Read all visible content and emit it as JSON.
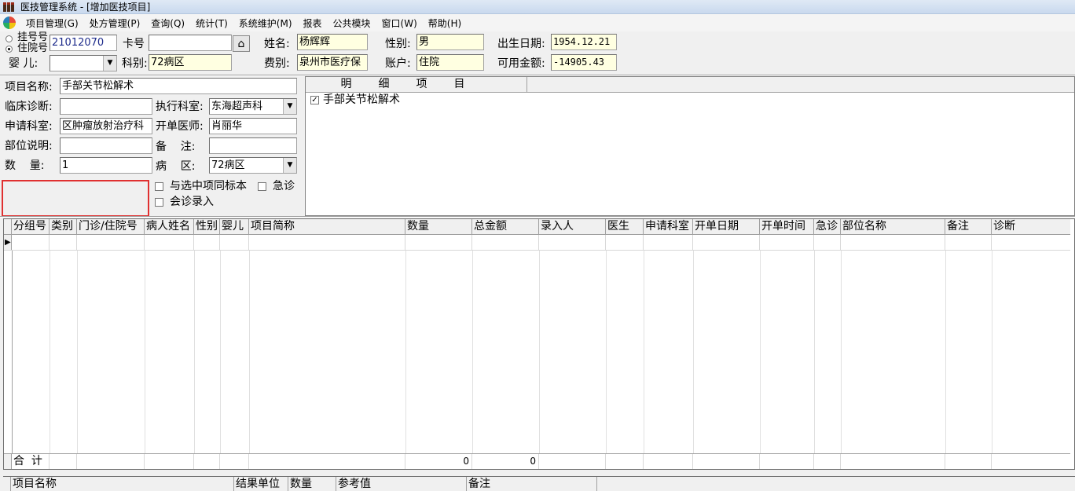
{
  "window": {
    "title": "医技管理系统 - [增加医技项目]"
  },
  "menu": [
    "项目管理(G)",
    "处方管理(P)",
    "查询(Q)",
    "统计(T)",
    "系统维护(M)",
    "报表",
    "公共模块",
    "窗口(W)",
    "帮助(H)"
  ],
  "patient": {
    "reg_no_label": "挂号号",
    "inpatient_no_label": "住院号",
    "inpatient_no": "21012070",
    "card_label": "卡号",
    "card_no": "",
    "name_label": "姓名:",
    "name": "杨辉辉",
    "gender_label": "性别:",
    "gender": "男",
    "birth_label": "出生日期:",
    "birth": "1954.12.21",
    "baby_label": "婴  儿:",
    "baby": "",
    "dept_label": "科别:",
    "dept": "72病区",
    "fee_label": "费别:",
    "fee": "泉州市医疗保",
    "account_label": "账户:",
    "account": "住院",
    "balance_label": "可用金额:",
    "balance": "-14905.43"
  },
  "form": {
    "item_name_label": "项目名称:",
    "item_name": "手部关节松解术",
    "diagnosis_label": "临床诊断:",
    "diagnosis": "",
    "exec_dept_label": "执行科室:",
    "exec_dept": "东海超声科",
    "apply_dept_label": "申请科室:",
    "apply_dept": "区肿瘤放射治疗科",
    "doctor_label": "开单医师:",
    "doctor": "肖丽华",
    "site_label": "部位说明:",
    "site": "",
    "remark_label": "备    注:",
    "remark": "",
    "qty_label": "数    量:",
    "qty": "1",
    "ward_label": "病    区:",
    "ward": "72病区",
    "same_sample_label": "与选中项同标本",
    "emergency_label": "急诊",
    "consult_label": "会诊录入"
  },
  "detail": {
    "header": "明细项目",
    "items": [
      {
        "label": "手部关节松解术",
        "checked": true
      }
    ]
  },
  "grid": {
    "columns": [
      "分组号",
      "类别",
      "门诊/住院号",
      "病人姓名",
      "性别",
      "婴儿",
      "项目简称",
      "数量",
      "总金额",
      "录入人",
      "医生",
      "申请科室",
      "开单日期",
      "开单时间",
      "急诊",
      "部位名称",
      "备注",
      "诊断"
    ],
    "total_label": "合  计",
    "total_qty": "0",
    "total_amount": "0"
  },
  "result_grid": {
    "columns": [
      "项目名称",
      "结果单位",
      "数量",
      "参考值",
      "备注"
    ]
  }
}
